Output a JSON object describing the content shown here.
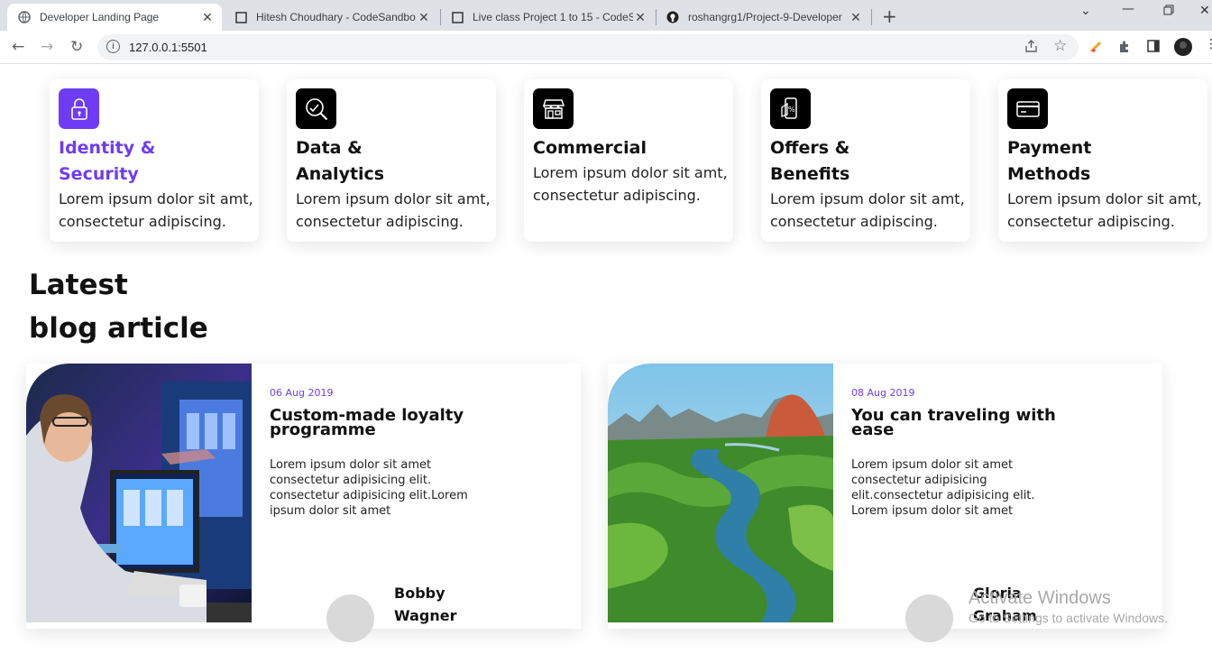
{
  "browser": {
    "tabs": [
      {
        "title": "Developer Landing Page",
        "active": true,
        "favicon": "globe-icon"
      },
      {
        "title": "Hitesh Choudhary - CodeSandbo",
        "favicon": "codesandbox-icon"
      },
      {
        "title": "Live class Project 1 to 15 - CodeS",
        "favicon": "codesandbox-icon"
      },
      {
        "title": "roshangrg1/Project-9-Developer",
        "favicon": "github-icon"
      }
    ],
    "new_tab": "+",
    "url": "127.0.0.1:5501"
  },
  "features": [
    {
      "title": "Identity & Security",
      "desc": "Lorem ipsum dolor sit amt, consectetur adipiscing.",
      "icon": "lock-icon",
      "accent": "#6f3cf5"
    },
    {
      "title": "Data & Analytics",
      "desc": "Lorem ipsum dolor sit amt, consectetur adipiscing.",
      "icon": "analytics-icon"
    },
    {
      "title": "Commercial",
      "desc": "Lorem ipsum dolor sit amt, consectetur adipiscing.",
      "icon": "store-icon"
    },
    {
      "title": "Offers & Benefits",
      "desc": "Lorem ipsum dolor sit amt, consectetur adipiscing.",
      "icon": "offers-icon"
    },
    {
      "title": "Payment Methods",
      "desc": "Lorem ipsum dolor sit amt, consectetur adipiscing.",
      "icon": "credit-card-icon"
    }
  ],
  "blog": {
    "heading_line1": "Latest",
    "heading_line2": "blog article",
    "articles": [
      {
        "date": "06 Aug 2019",
        "title": "Custom-made loyalty programme",
        "desc": "Lorem ipsum dolor sit amet consectetur adipisicing elit. consectetur adipisicing elit.Lorem ipsum dolor sit amet",
        "author_first": "Bobby",
        "author_last": "Wagner"
      },
      {
        "date": "08 Aug 2019",
        "title": "You can traveling with ease",
        "desc": "Lorem ipsum dolor sit amet consectetur adipisicing elit.consectetur adipisicing elit. Lorem ipsum dolor sit amet",
        "author_first": "Gloria",
        "author_last": "Graham"
      }
    ]
  },
  "watermark": {
    "line1": "Activate Windows",
    "line2": "Go to Settings to activate Windows."
  },
  "colors": {
    "accent": "#6f3cf5",
    "icon_bg": "#000000"
  }
}
